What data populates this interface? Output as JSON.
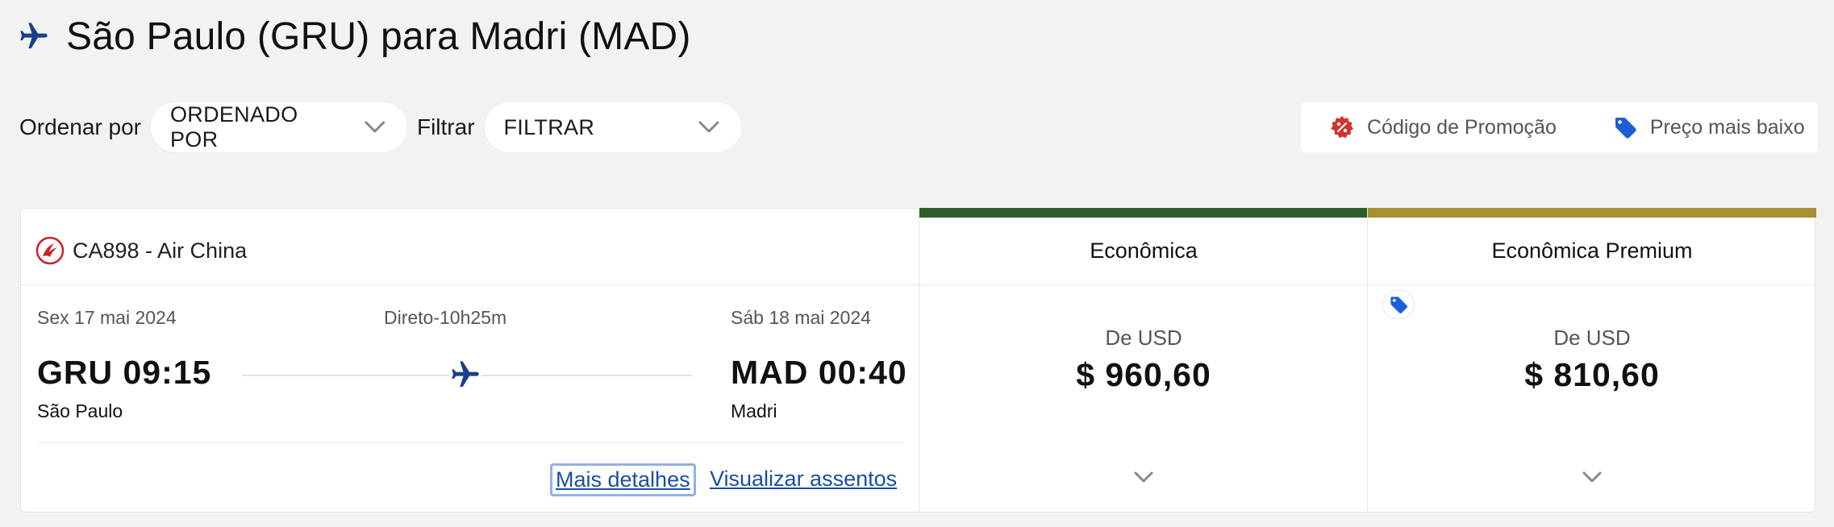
{
  "header": {
    "title": "São Paulo (GRU) para Madri (MAD)",
    "icon": "airplane-icon"
  },
  "toolbar": {
    "sort_label": "Ordenar por",
    "sort_value": "ORDENADO POR",
    "filter_label": "Filtrar",
    "filter_value": "FILTRAR"
  },
  "legend": {
    "promo_code": "Código de Promoção",
    "lowest_price": "Preço mais baixo"
  },
  "flight": {
    "airline": "CA898 - Air China",
    "departure_date": "Sex 17 mai 2024",
    "arrival_date": "Sáb 18 mai 2024",
    "duration": "Direto-10h25m",
    "departure_time": "GRU 09:15",
    "arrival_time": "MAD 00:40",
    "departure_city": "São Paulo",
    "arrival_city": "Madri",
    "details_link": "Mais detalhes",
    "seats_link": "Visualizar assentos"
  },
  "fares": [
    {
      "name": "Econômica",
      "from_label": "De USD",
      "price": "$ 960,60",
      "accent": "#2d5e2a"
    },
    {
      "name": "Econômica Premium",
      "from_label": "De USD",
      "price": "$ 810,60",
      "accent": "#a89030",
      "lowest_price_tag": true
    }
  ],
  "colors": {
    "brand_blue": "#1a4fa0",
    "promo_red": "#d2322d",
    "tag_blue": "#1b5fd6"
  }
}
